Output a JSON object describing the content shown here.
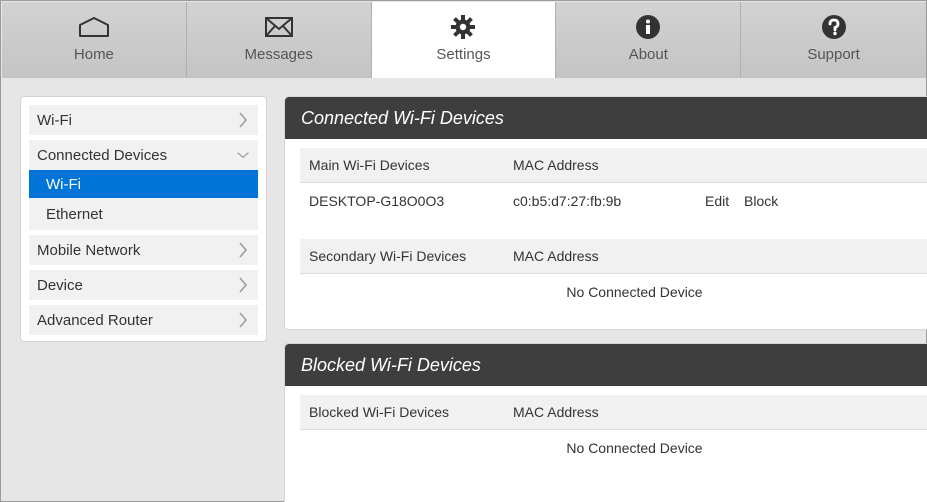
{
  "nav": {
    "tabs": [
      {
        "label": "Home",
        "icon": "home-icon",
        "active": false
      },
      {
        "label": "Messages",
        "icon": "envelope-icon",
        "active": false
      },
      {
        "label": "Settings",
        "icon": "gear-icon",
        "active": true
      },
      {
        "label": "About",
        "icon": "info-icon",
        "active": false
      },
      {
        "label": "Support",
        "icon": "question-icon",
        "active": false
      }
    ]
  },
  "sidebar": {
    "items": [
      {
        "label": "Wi-Fi"
      },
      {
        "label": "Connected Devices"
      },
      {
        "label": "Mobile Network"
      },
      {
        "label": "Device"
      },
      {
        "label": "Advanced Router"
      }
    ],
    "sub_items": [
      {
        "label": "Wi-Fi",
        "selected": true
      },
      {
        "label": "Ethernet",
        "selected": false
      }
    ],
    "selected_color": "#0074d9"
  },
  "connected": {
    "title": "Connected Wi-Fi Devices",
    "main_header": {
      "device": "Main Wi-Fi Devices",
      "mac": "MAC Address"
    },
    "main_rows": [
      {
        "device": "DESKTOP-G18O0O3",
        "mac": "c0:b5:d7:27:fb:9b",
        "edit": "Edit",
        "block": "Block"
      }
    ],
    "secondary_header": {
      "device": "Secondary Wi-Fi Devices",
      "mac": "MAC Address"
    },
    "secondary_empty": "No Connected Device"
  },
  "blocked": {
    "title": "Blocked Wi-Fi Devices",
    "header": {
      "device": "Blocked Wi-Fi Devices",
      "mac": "MAC Address"
    },
    "empty": "No Connected Device"
  }
}
